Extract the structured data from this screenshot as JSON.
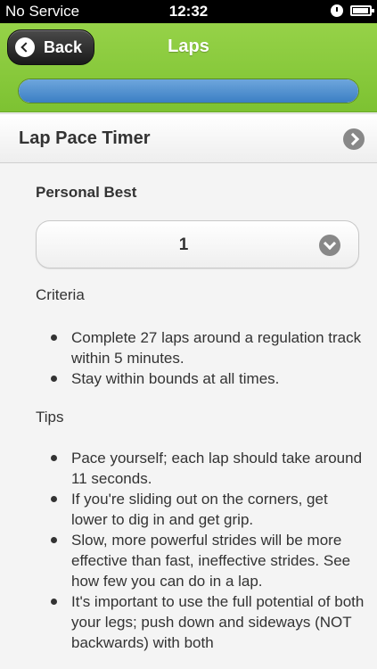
{
  "status_bar": {
    "carrier": "No Service",
    "time": "12:32"
  },
  "header": {
    "back_label": "Back",
    "title": "Laps",
    "progress_fraction": 1.0
  },
  "section": {
    "title": "Lap Pace Timer"
  },
  "personal_best": {
    "label": "Personal Best",
    "selected_value": "1"
  },
  "criteria": {
    "heading": "Criteria",
    "items": [
      "Complete 27 laps around a regulation track within 5 minutes.",
      "Stay within bounds at all times."
    ]
  },
  "tips": {
    "heading": "Tips",
    "items": [
      "Pace yourself; each lap should take around 11 seconds.",
      "If you're sliding out on the corners, get lower to dig in and get grip.",
      "Slow, more powerful strides will be more effective than fast, ineffective strides. See how few you can do in a lap.",
      "It's important to use the full potential of both your legs; push down and sideways (NOT backwards) with both"
    ]
  },
  "icons": {
    "back": "back-arrow-icon",
    "section": "chevron-right-icon",
    "select": "chevron-down-icon",
    "status": [
      "lock-icon",
      "battery-icon"
    ]
  },
  "colors": {
    "header_green": "#8ccb3e",
    "progress_blue": "#4a8fd0",
    "status_black": "#000000"
  }
}
